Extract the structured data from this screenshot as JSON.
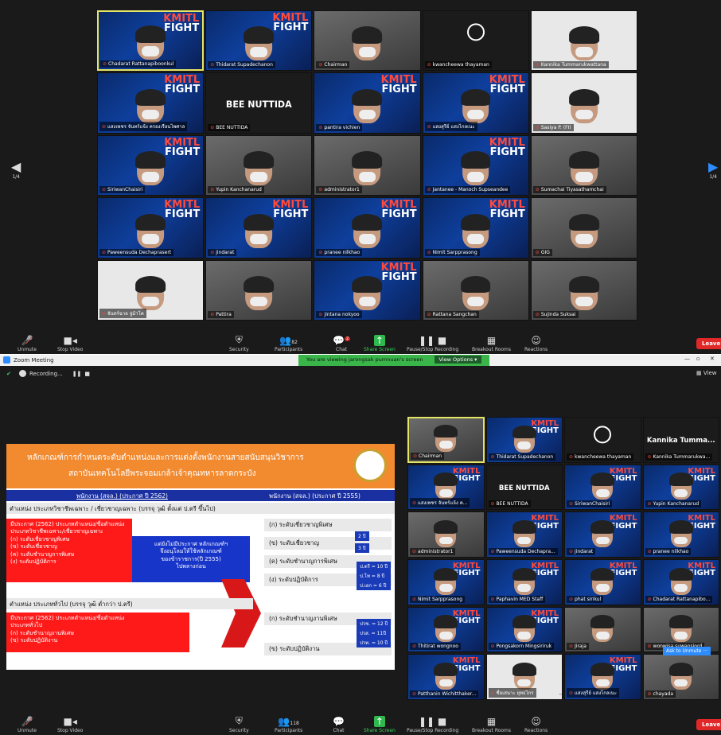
{
  "top_window": {
    "page_indicator": "1/4",
    "tiles": [
      {
        "name": "Chadarat Rattanapiboonkul",
        "kind": "kmitl",
        "selected": true
      },
      {
        "name": "Thidarat Supadechanon",
        "kind": "kmitl"
      },
      {
        "name": "Chairman",
        "kind": "cam"
      },
      {
        "name": "kwancheewa thayaman",
        "kind": "obs"
      },
      {
        "name": "Kannika Tummarukwattana",
        "kind": "white"
      },
      {
        "name": "แสงเพชร จันทร์แจ้ง ครองเรือนไพศาล",
        "kind": "kmitl"
      },
      {
        "name": "BEE NUTTIDA",
        "kind": "text",
        "big": "BEE NUTTIDA"
      },
      {
        "name": "pantira vichien",
        "kind": "kmitl"
      },
      {
        "name": "แสงสุรีย์ แสงไกลเนะ",
        "kind": "kmitl"
      },
      {
        "name": "Sasiya P. (FI)",
        "kind": "white"
      },
      {
        "name": "SiriwanChaisiri",
        "kind": "kmitl"
      },
      {
        "name": "Yupin Kanchanarud",
        "kind": "cam"
      },
      {
        "name": "administrator1",
        "kind": "cam"
      },
      {
        "name": "Jantanee - Manoch Supseandee",
        "kind": "kmitl"
      },
      {
        "name": "Sumachai Tiyasathamchai",
        "kind": "cam"
      },
      {
        "name": "Paweensuda Dechaprasert",
        "kind": "kmitl"
      },
      {
        "name": "jindarat",
        "kind": "kmitl"
      },
      {
        "name": "pranee nilkhao",
        "kind": "kmitl"
      },
      {
        "name": "Nimit Sarpprasong",
        "kind": "kmitl"
      },
      {
        "name": "GIG",
        "kind": "cam"
      },
      {
        "name": "จันทร์ฉาย จู่ม้าโค",
        "kind": "white"
      },
      {
        "name": "Pattira",
        "kind": "cam"
      },
      {
        "name": "jintana nokyoo",
        "kind": "kmitl"
      },
      {
        "name": "Rattana Sangchan",
        "kind": "cam"
      },
      {
        "name": "Sujinda Suksai",
        "kind": "cam"
      }
    ],
    "toolbar": {
      "unmute": "Unmute",
      "stop_video": "Stop Video",
      "security": "Security",
      "participants": "Participants",
      "participants_count": "82",
      "chat": "Chat",
      "chat_badge": "2",
      "share_screen": "Share Screen",
      "recording": "Pause/Stop Recording",
      "breakout": "Breakout Rooms",
      "reactions": "Reactions",
      "leave": "Leave"
    }
  },
  "bottom_window": {
    "title": "Zoom Meeting",
    "share_notice": "You are viewing jarongsak pumnuan's screen",
    "view_options": "View Options",
    "recording_label": "Recording...",
    "view_label": "View",
    "slide": {
      "title_line1": "หลักเกณฑ์การกำหนดระดับตำแหน่งและการแต่งตั้งพนักงานสายสนับสนุนวิชาการ",
      "title_line2": "สถาบันเทคโนโลยีพระจอมเกล้าเจ้าคุณทหารลาดกระบัง",
      "col_left": "พนักงาน (สจล.) (ประกาศ ปี 2562)",
      "col_right": "พนักงาน (สจล.) (ประกาศ ปี 2555)",
      "section1": "ตำแหน่ง ประเภทวิชาชีพเฉพาะ / เชี่ยวชาญเฉพาะ (บรรจุ วุฒิ ตั้งแต่ ป.ตรี ขึ้นไป)",
      "red1": [
        "มีประกาศ (2562) ประเภทตำแหน่ง/ชื่อตำแหน่ง",
        "ประเภทวิชาชีพเฉพาะ/เชี่ยวชาญเฉพาะ",
        "(ก) ระดับเชี่ยวชาญพิเศษ",
        "(ข) ระดับเชี่ยวชาญ",
        "(ค) ระดับชำนาญการพิเศษ",
        "(ง) ระดับปฏิบัติการ"
      ],
      "blue": [
        "แต่ยังไม่มีประกาศ หลักเกณฑ์ฯ",
        "จึงอนุโลมให้ใช้หลักเกณฑ์",
        "ของข้าราชการ(ปี 2555)",
        "ไปพลางก่อน"
      ],
      "right1": [
        "(ก) ระดับเชี่ยวชาญพิเศษ",
        "(ข) ระดับเชี่ยวชาญ",
        "(ค) ระดับชำนาญการพิเศษ",
        "(ง) ระดับปฏิบัติการ"
      ],
      "years1": [
        "2 ปี",
        "3 ปี"
      ],
      "years2": [
        "ป.ตรี = 10 ปี",
        "ป.โท = 8 ปี",
        "ป.เอก = 6 ปี"
      ],
      "section2": "ตำแหน่ง ประเภททั่วไป (บรรจุ วุฒิ ต่ำกว่า ป.ตรี)",
      "red2": [
        "มีประกาศ (2562) ประเภทตำแหน่ง/ชื่อตำแหน่ง",
        "ประเภททั่วไป",
        "(ก) ระดับชำนาญงานพิเศษ",
        "(ข) ระดับปฏิบัติงาน"
      ],
      "right2": [
        "(ก) ระดับชำนาญงานพิเศษ",
        "(ข) ระดับปฏิบัติงาน"
      ],
      "years3": [
        "ปวช. = 12 ปี",
        "ปวส. = 11ปี",
        "ปวท. = 10 ปี"
      ]
    },
    "tiles": [
      {
        "name": "Chairman",
        "kind": "cam",
        "selected": true
      },
      {
        "name": "Thidarat Supadechanon",
        "kind": "kmitl"
      },
      {
        "name": "kwancheewa thayaman",
        "kind": "obs"
      },
      {
        "name": "Kannika Tummarukwa...",
        "kind": "text",
        "big": "Kannika  Tumma..."
      },
      {
        "name": "แสงเพชร จันทร์แจ้ง ค...",
        "kind": "kmitl"
      },
      {
        "name": "BEE NUTTIDA",
        "kind": "text",
        "big": "BEE NUTTIDA"
      },
      {
        "name": "SiriwanChaisiri",
        "kind": "kmitl"
      },
      {
        "name": "Yupin Kanchanarud",
        "kind": "kmitl"
      },
      {
        "name": "administrator1",
        "kind": "cam"
      },
      {
        "name": "Paweensuda Dechapra...",
        "kind": "kmitl"
      },
      {
        "name": "jindarat",
        "kind": "kmitl"
      },
      {
        "name": "pranee nilkhao",
        "kind": "kmitl"
      },
      {
        "name": "Nimit Sarpprasong",
        "kind": "kmitl"
      },
      {
        "name": "Paphavin MED Staff",
        "kind": "kmitl"
      },
      {
        "name": "phat sirikul",
        "kind": "kmitl"
      },
      {
        "name": "Chadarat Rattanapibo...",
        "kind": "kmitl"
      },
      {
        "name": "Thitirat wongnoo",
        "kind": "kmitl"
      },
      {
        "name": "Pongsakorn Mingsiriruk",
        "kind": "kmitl"
      },
      {
        "name": "Jiraja",
        "kind": "cam"
      },
      {
        "name": "wonwisa suwansiord",
        "kind": "cam"
      },
      {
        "name": "Patthanin Wichitthaker...",
        "kind": "kmitl"
      },
      {
        "name": "ชื่อเสนาะ ยุทธไกร",
        "kind": "white"
      },
      {
        "name": "แสงสุรีย์ แสงไกลเนะ",
        "kind": "kmitl"
      },
      {
        "name": "chayada",
        "kind": "cam"
      }
    ],
    "ask_unmute": "Ask to Unmute",
    "toolbar": {
      "unmute": "Unmute",
      "stop_video": "Stop Video",
      "security": "Security",
      "participants": "Participants",
      "participants_count": "118",
      "chat": "Chat",
      "share_screen": "Share Screen",
      "recording": "Pause/Stop Recording",
      "breakout": "Breakout Rooms",
      "reactions": "Reactions",
      "leave": "Leave"
    },
    "logo_text": {
      "top": "KMITL",
      "bottom": "FIGHT"
    }
  }
}
